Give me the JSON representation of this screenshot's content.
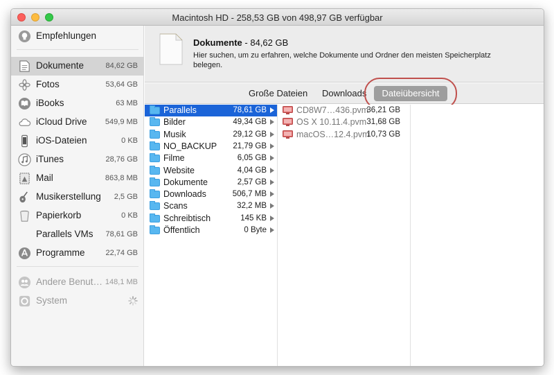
{
  "window": {
    "title": "Macintosh HD - 258,53 GB von 498,97 GB verfügbar"
  },
  "sidebar": {
    "items": [
      {
        "label": "Empfehlungen",
        "size": "",
        "icon": "lightbulb-icon"
      },
      {
        "label": "Dokumente",
        "size": "84,62 GB",
        "icon": "document-icon"
      },
      {
        "label": "Fotos",
        "size": "53,64 GB",
        "icon": "photos-icon"
      },
      {
        "label": "iBooks",
        "size": "63 MB",
        "icon": "ibooks-icon"
      },
      {
        "label": "iCloud Drive",
        "size": "549,9 MB",
        "icon": "cloud-icon"
      },
      {
        "label": "iOS-Dateien",
        "size": "0 KB",
        "icon": "iphone-icon"
      },
      {
        "label": "iTunes",
        "size": "28,76 GB",
        "icon": "music-note-icon"
      },
      {
        "label": "Mail",
        "size": "863,8 MB",
        "icon": "stamp-icon"
      },
      {
        "label": "Musikerstellung",
        "size": "2,5 GB",
        "icon": "guitar-icon"
      },
      {
        "label": "Papierkorb",
        "size": "0 KB",
        "icon": "trash-icon"
      },
      {
        "label": "Parallels VMs",
        "size": "78,61 GB",
        "icon": ""
      },
      {
        "label": "Programme",
        "size": "22,74 GB",
        "icon": "appstore-icon"
      },
      {
        "label": "Andere Benut…",
        "size": "148,1 MB",
        "icon": "users-icon"
      },
      {
        "label": "System",
        "size": "",
        "icon": "gear-icon"
      }
    ],
    "selected": "Dokumente"
  },
  "header": {
    "title": "Dokumente",
    "size": " - 84,62 GB",
    "description": "Hier suchen, um zu erfahren, welche Dokumente und Ordner den meisten Speicherplatz belegen."
  },
  "tabs": {
    "large_files": "Große Dateien",
    "downloads": "Downloads",
    "file_browser": "Dateiübersicht",
    "active": "Dateiübersicht",
    "highlight_color": "#c0504d"
  },
  "browser": {
    "folders": [
      {
        "name": "Parallels",
        "size": "78,61 GB"
      },
      {
        "name": "Bilder",
        "size": "49,34 GB"
      },
      {
        "name": "Musik",
        "size": "29,12 GB"
      },
      {
        "name": "NO_BACKUP",
        "size": "21,79 GB"
      },
      {
        "name": "Filme",
        "size": "6,05 GB"
      },
      {
        "name": "Website",
        "size": "4,04 GB"
      },
      {
        "name": "Dokumente",
        "size": "2,57 GB"
      },
      {
        "name": "Downloads",
        "size": "506,7 MB"
      },
      {
        "name": "Scans",
        "size": "32,2 MB"
      },
      {
        "name": "Schreibtisch",
        "size": "145 KB"
      },
      {
        "name": "Öffentlich",
        "size": "0 Byte"
      }
    ],
    "selected_folder": "Parallels",
    "selection_color": "#1b64d8",
    "files": [
      {
        "name": "CD8W7…436.pvm",
        "size": "36,21 GB"
      },
      {
        "name": "OS X 10.11.4.pvm",
        "size": "31,68 GB"
      },
      {
        "name": "macOS…12.4.pvm",
        "size": "10,73 GB"
      }
    ]
  }
}
